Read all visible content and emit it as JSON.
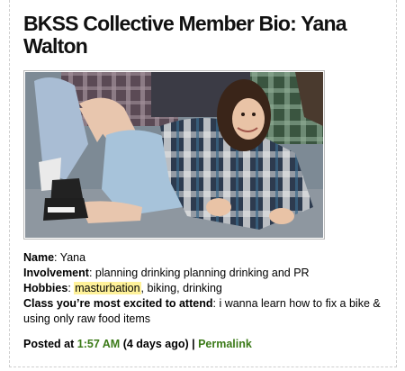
{
  "post": {
    "title": "BKSS Collective Member Bio: Yana Walton",
    "photo_alt": "photo",
    "bio": {
      "name_label": "Name",
      "name_value": "Yana",
      "involvement_label": "Involvement",
      "involvement_value": "planning drinking planning drinking and PR",
      "hobbies_label": "Hobbies",
      "hobby_highlight": "masturbation",
      "hobbies_rest": ", biking, drinking",
      "class_label": "Class you’re most excited to attend",
      "class_value": "i wanna learn how to fix a bike & using only raw food items"
    },
    "meta": {
      "posted_prefix": "Posted at ",
      "time": "1:57 AM",
      "ago": " (4 days ago) | ",
      "permalink": "Permalink"
    }
  },
  "colors": {
    "link_green": "#3b7a18",
    "highlight": "#fff29a"
  }
}
